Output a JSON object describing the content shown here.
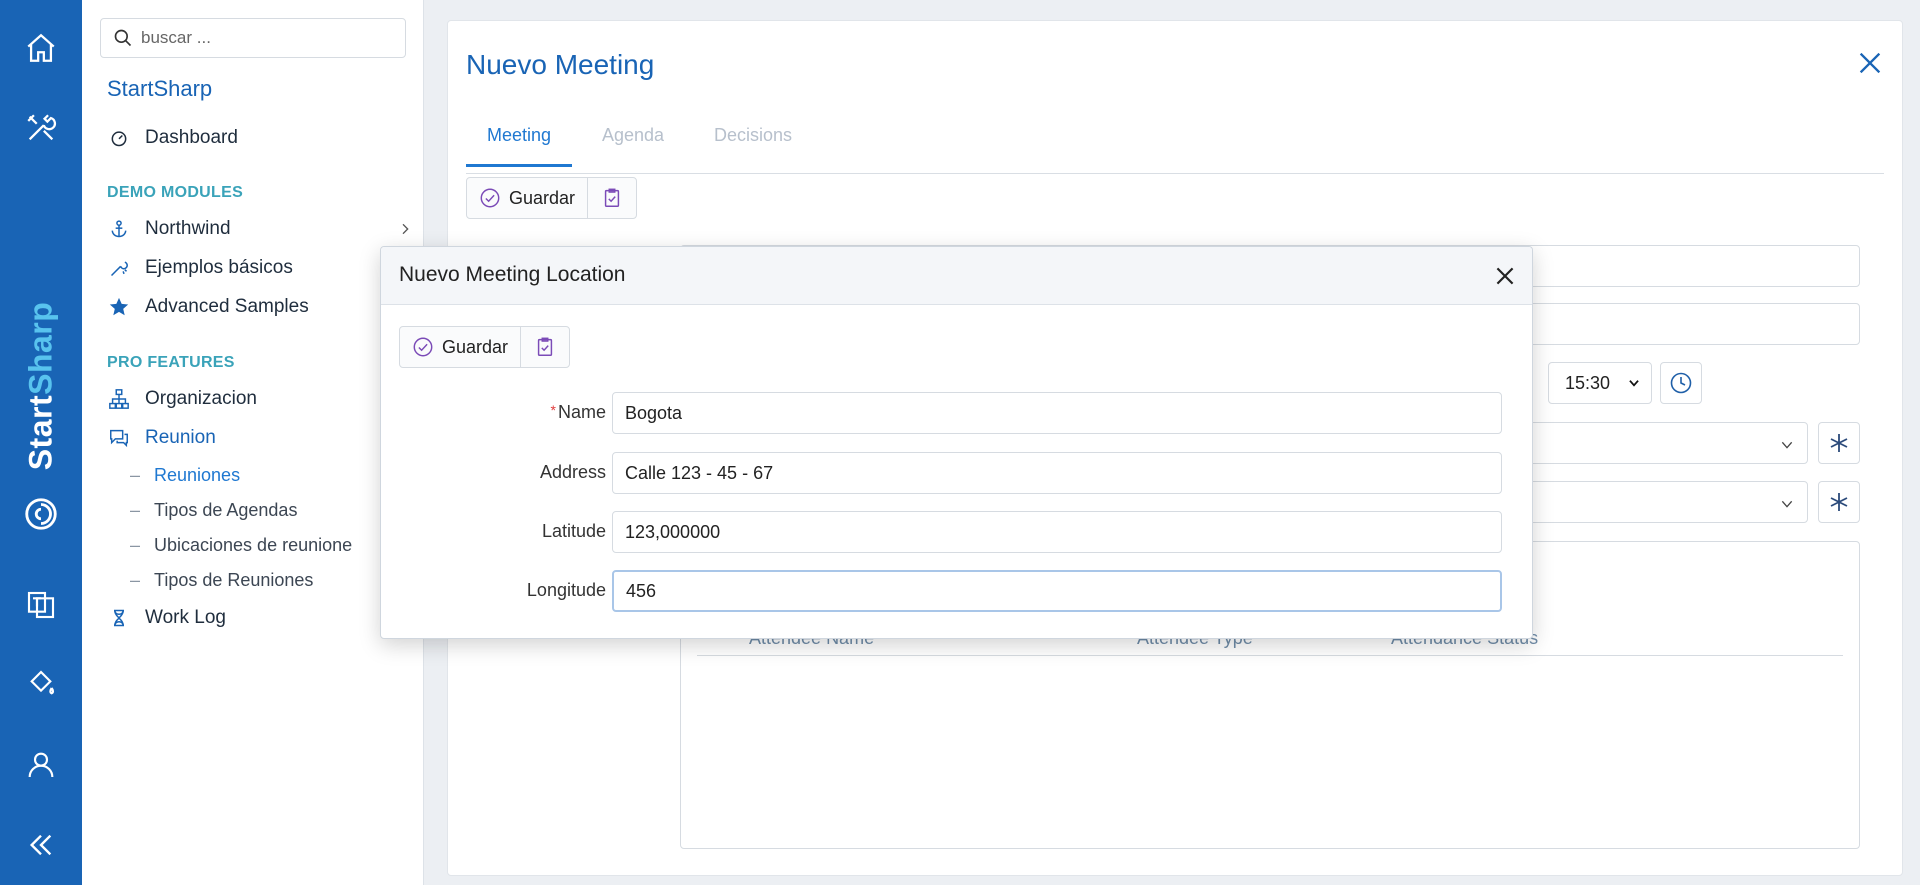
{
  "rail": {
    "brand_start": "Start",
    "brand_sharp": "Sharp"
  },
  "sidebar": {
    "search_placeholder": "buscar ...",
    "title": "StartSharp",
    "dashboard": "Dashboard",
    "section_demo": "DEMO MODULES",
    "northwind": "Northwind",
    "ejemplos": "Ejemplos básicos",
    "advanced": "Advanced Samples",
    "section_pro": "PRO FEATURES",
    "organizacion": "Organizacion",
    "reunion": "Reunion",
    "sub": [
      "Reuniones",
      "Tipos de Agendas",
      "Ubicaciones de reunione",
      "Tipos de Reuniones"
    ],
    "worklog": "Work Log"
  },
  "panel": {
    "title": "Nuevo Meeting",
    "tabs": [
      "Meeting",
      "Agenda",
      "Decisions"
    ],
    "save_label": "Guardar",
    "time_value": "15:30",
    "grid_headers": [
      "Attendee Name",
      "Attendee Type",
      "Attendance Status"
    ]
  },
  "modal": {
    "title": "Nuevo Meeting Location",
    "save_label": "Guardar",
    "fields": {
      "name_label": "Name",
      "name_value": "Bogota",
      "address_label": "Address",
      "address_value": "Calle 123 - 45 - 67",
      "latitude_label": "Latitude",
      "latitude_value": "123,000000",
      "longitude_label": "Longitude",
      "longitude_value": "456"
    }
  },
  "colors": {
    "rail": "#1964b5",
    "accent": "#1f78d1",
    "section": "#3aa3b9",
    "purple_icon": "#7b4bb7"
  }
}
